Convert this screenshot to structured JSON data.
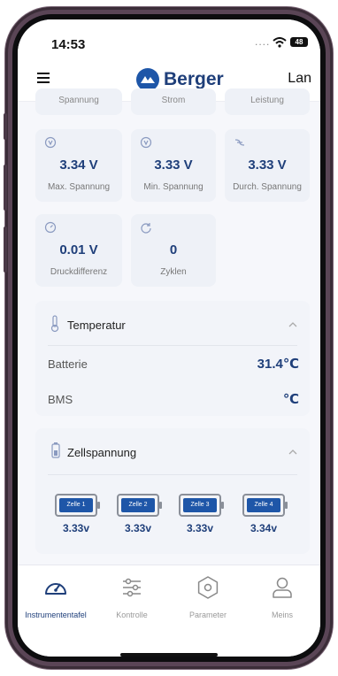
{
  "status": {
    "time": "14:53",
    "signal": "....",
    "battery": "48"
  },
  "header": {
    "brand": "Berger",
    "language": "Lan"
  },
  "top_partial": [
    {
      "label": "Spannung"
    },
    {
      "label": "Strom"
    },
    {
      "label": "Leistung"
    }
  ],
  "stats": [
    {
      "value": "3.34 V",
      "label": "Max. Spannung",
      "icon": "max-voltage-icon"
    },
    {
      "value": "3.33 V",
      "label": "Min. Spannung",
      "icon": "min-voltage-icon"
    },
    {
      "value": "3.33 V",
      "label": "Durch. Spannung",
      "icon": "avg-voltage-icon"
    },
    {
      "value": "0.01 V",
      "label": "Druckdifferenz",
      "icon": "pressure-diff-icon"
    },
    {
      "value": "0",
      "label": "Zyklen",
      "icon": "cycles-icon"
    }
  ],
  "temperature": {
    "title": "Temperatur",
    "rows": [
      {
        "label": "Batterie",
        "value": "31.4℃"
      },
      {
        "label": "BMS",
        "value": "℃"
      }
    ]
  },
  "cells": {
    "title": "Zellspannung",
    "items": [
      {
        "name": "Zelle 1",
        "value": "3.33v"
      },
      {
        "name": "Zelle 2",
        "value": "3.33v"
      },
      {
        "name": "Zelle 3",
        "value": "3.33v"
      },
      {
        "name": "Zelle 4",
        "value": "3.34v"
      }
    ]
  },
  "tabs": [
    {
      "label": "Instrumententafel",
      "icon": "dashboard-gauge-icon",
      "active": true
    },
    {
      "label": "Kontrolle",
      "icon": "sliders-icon",
      "active": false
    },
    {
      "label": "Parameter",
      "icon": "hexagon-nut-icon",
      "active": false
    },
    {
      "label": "Meins",
      "icon": "user-icon",
      "active": false
    }
  ],
  "colors": {
    "accent": "#1f3f7a",
    "brand": "#1e56a8",
    "card": "#eef1f7",
    "frame": "#5a4556"
  }
}
